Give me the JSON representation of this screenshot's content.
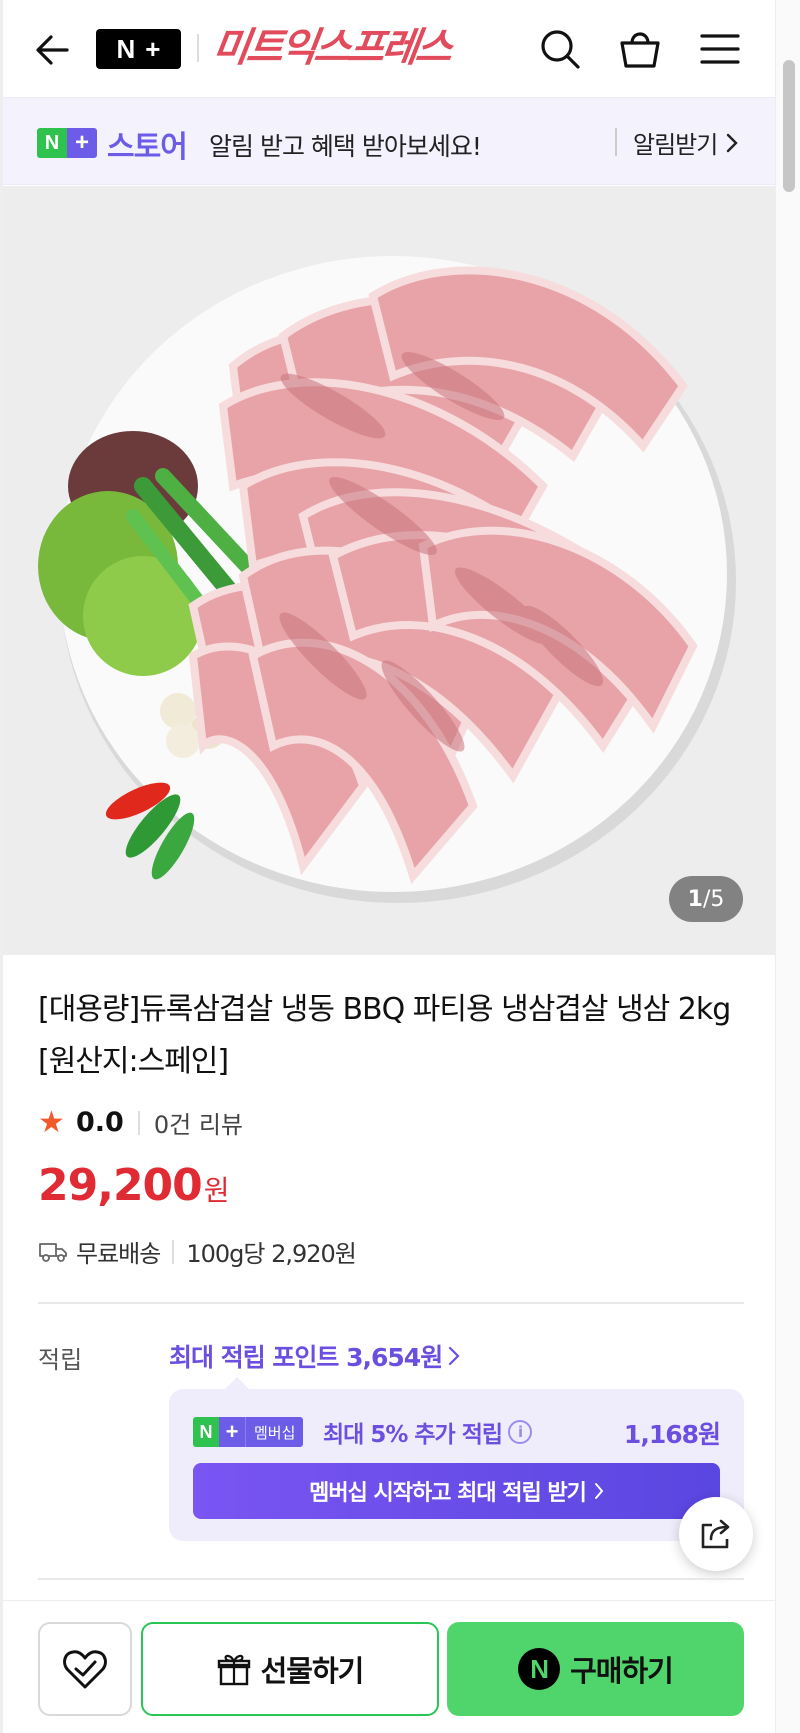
{
  "header": {
    "logo_n": "N",
    "logo_plus": "+",
    "store_name": "미트익스프레스"
  },
  "notify": {
    "badge_n": "N",
    "badge_plus": "+",
    "store_label": "스토어",
    "message": "알림 받고 혜택 받아보세요!",
    "button_label": "알림받기"
  },
  "product": {
    "image_counter_current": "1",
    "image_counter_sep": "/",
    "image_counter_total": "5",
    "title": "[대용량]듀록삼겹살 냉동 BBQ 파티용 냉삼겹살 냉삼 2kg [원산지:스페인]",
    "rating": "0.0",
    "review_count": "0건 리뷰",
    "price": "29,200",
    "price_unit": "원",
    "shipping": "무료배송",
    "unit_price": "100g당 2,920원"
  },
  "points": {
    "label": "적립",
    "max_points_link": "최대 적립 포인트 3,654원",
    "membership_badge_n": "N",
    "membership_badge_plus": "+",
    "membership_badge_text": "멤버십",
    "membership_text": "최대 5% 추가 적립",
    "membership_amount": "1,168원",
    "membership_cta": "멤버십 시작하고 최대 적립 받기"
  },
  "bottom_bar": {
    "gift_label": "선물하기",
    "buy_icon_letter": "N",
    "buy_label": "구매하기"
  },
  "colors": {
    "brand_red": "#e24b5b",
    "price_red": "#e02b34",
    "naver_green": "#4fd56b",
    "membership_purple": "#6a4fe0"
  },
  "icons": [
    "back-arrow-icon",
    "search-icon",
    "shopping-bag-icon",
    "hamburger-menu-icon",
    "chevron-right-icon",
    "star-icon",
    "truck-icon",
    "info-icon",
    "share-icon",
    "heart-check-icon",
    "gift-icon",
    "naver-pay-icon"
  ]
}
